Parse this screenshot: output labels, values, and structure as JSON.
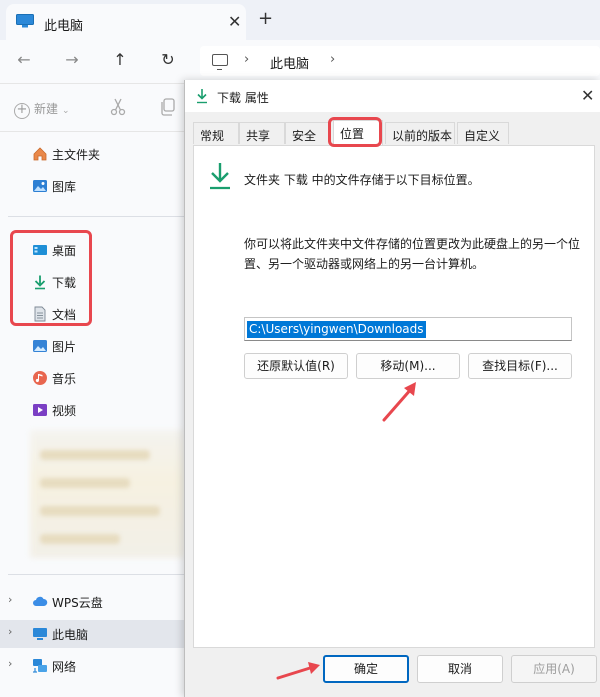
{
  "explorer": {
    "tab_title": "此电脑",
    "tab_close": "✕",
    "tab_new": "+",
    "nav": {
      "back": "←",
      "forward": "→",
      "up": "↑",
      "refresh": "↻"
    },
    "address": {
      "location": "此电脑",
      "separator": "›"
    },
    "toolbar": {
      "new_label": "新建",
      "new_plus": "+",
      "new_caret": "⌄"
    },
    "sidebar": {
      "home": "主文件夹",
      "gallery": "图库",
      "desktop": "桌面",
      "downloads": "下载",
      "documents": "文档",
      "pictures": "图片",
      "music": "音乐",
      "videos": "视频",
      "wps_cloud": "WPS云盘",
      "this_pc": "此电脑",
      "network": "网络",
      "chevron": "›"
    }
  },
  "dialog": {
    "title": "下载 属性",
    "close": "✕",
    "tabs": [
      "常规",
      "共享",
      "安全",
      "位置",
      "以前的版本",
      "自定义"
    ],
    "selected_tab": "位置",
    "heading": "文件夹 下载 中的文件存储于以下目标位置。",
    "description": "你可以将此文件夹中文件存储的位置更改为此硬盘上的另一个位置、另一个驱动器或网络上的另一台计算机。",
    "path": "C:\\Users\\yingwen\\Downloads",
    "buttons": {
      "restore": "还原默认值(R)",
      "move": "移动(M)...",
      "find": "查找目标(F)..."
    },
    "footer": {
      "ok": "确定",
      "cancel": "取消",
      "apply": "应用(A)"
    }
  },
  "colors": {
    "highlight": "#e8474e",
    "accent": "#0078d7",
    "download_green": "#1a9e6e"
  }
}
